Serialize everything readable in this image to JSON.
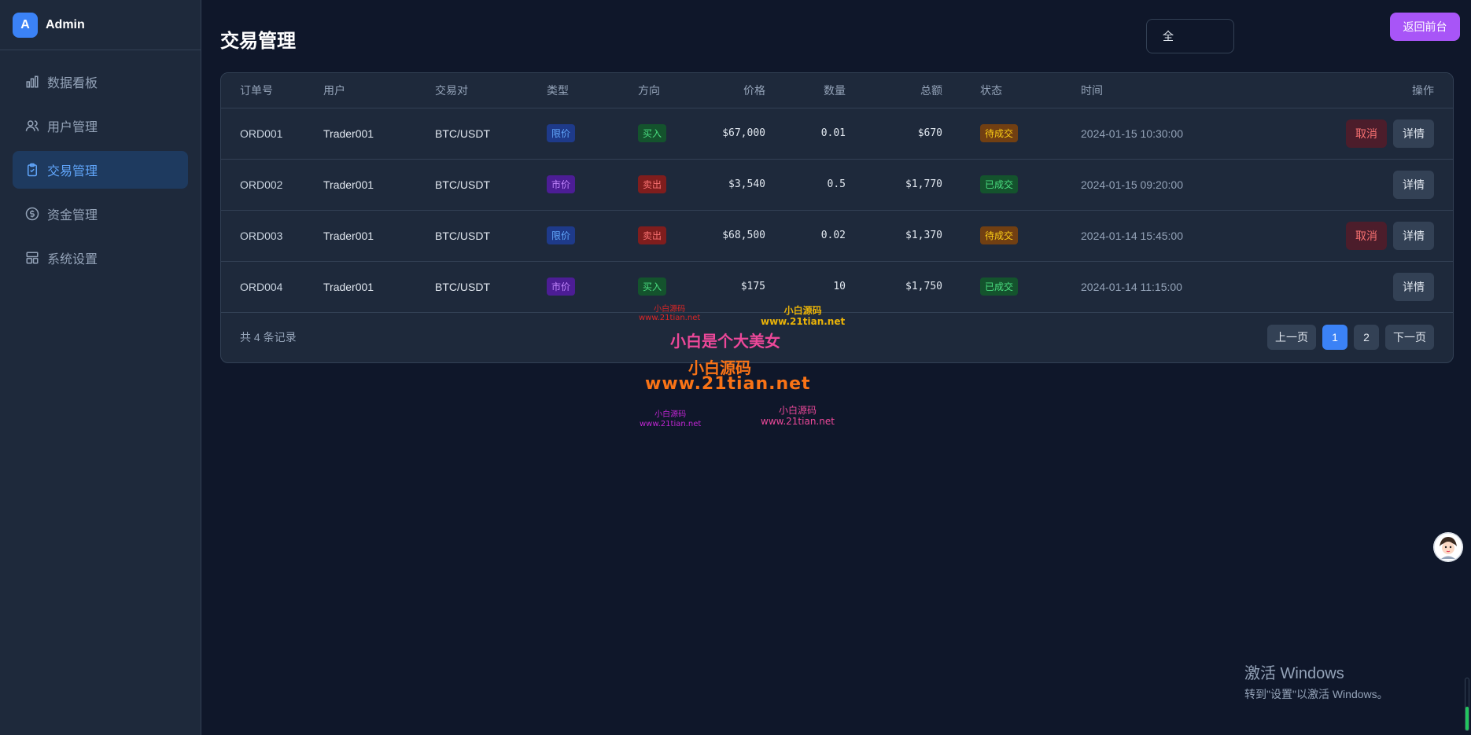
{
  "brand": {
    "logo": "A",
    "title": "Admin"
  },
  "nav": [
    {
      "label": "数据看板",
      "icon": "bar-chart-icon",
      "active": false
    },
    {
      "label": "用户管理",
      "icon": "users-icon",
      "active": false
    },
    {
      "label": "交易管理",
      "icon": "clipboard-check-icon",
      "active": true
    },
    {
      "label": "资金管理",
      "icon": "dollar-circle-icon",
      "active": false
    },
    {
      "label": "系统设置",
      "icon": "layout-settings-icon",
      "active": false
    }
  ],
  "header": {
    "title": "交易管理",
    "all_button": "全",
    "front_button": "返回前台"
  },
  "table": {
    "columns": [
      "订单号",
      "用户",
      "交易对",
      "类型",
      "方向",
      "价格",
      "数量",
      "总额",
      "状态",
      "时间",
      "操作"
    ],
    "rows": [
      {
        "order": "ORD001",
        "user": "Trader001",
        "pair": "BTC/USDT",
        "type": "限价",
        "dir": "买入",
        "price": "$67,000",
        "qty": "0.01",
        "total": "$670",
        "status": "待成交",
        "time": "2024-01-15 10:30:00",
        "cancel": "取消",
        "detail": "详情"
      },
      {
        "order": "ORD002",
        "user": "Trader001",
        "pair": "BTC/USDT",
        "type": "市价",
        "dir": "卖出",
        "price": "$3,540",
        "qty": "0.5",
        "total": "$1,770",
        "status": "已成交",
        "time": "2024-01-15 09:20:00",
        "cancel": "",
        "detail": "详情"
      },
      {
        "order": "ORD003",
        "user": "Trader001",
        "pair": "BTC/USDT",
        "type": "限价",
        "dir": "卖出",
        "price": "$68,500",
        "qty": "0.02",
        "total": "$1,370",
        "status": "待成交",
        "time": "2024-01-14 15:45:00",
        "cancel": "取消",
        "detail": "详情"
      },
      {
        "order": "ORD004",
        "user": "Trader001",
        "pair": "BTC/USDT",
        "type": "市价",
        "dir": "买入",
        "price": "$175",
        "qty": "10",
        "total": "$1,750",
        "status": "已成交",
        "time": "2024-01-14 11:15:00",
        "cancel": "",
        "detail": "详情"
      }
    ]
  },
  "footer": {
    "total": "共 4 条记录",
    "prev": "上一页",
    "page1": "1",
    "page2": "2",
    "next": "下一页"
  },
  "watermarks": {
    "small1_a": "小白源码",
    "small1_b": "www.21tian.net",
    "small2_a": "小白源码",
    "small2_b": "www.21tian.net",
    "big1": "小白是个大美女",
    "big2": "小白源码",
    "big3": "www.21tian.net",
    "small3_a": "小白源码",
    "small3_b": "www.21tian.net",
    "small4_a": "小白源码",
    "small4_b": "www.21tian.net"
  },
  "windows": {
    "line1": "激活 Windows",
    "line2": "转到\"设置\"以激活 Windows。"
  },
  "colors": {
    "accent": "#3b82f6",
    "purple": "#a855f7",
    "bg": "#0f172a",
    "panel": "#1e293b"
  }
}
